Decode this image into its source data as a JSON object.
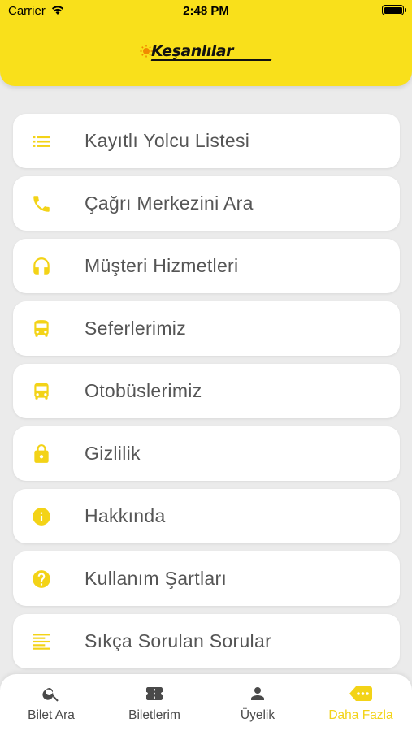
{
  "status_bar": {
    "carrier": "Carrier",
    "time": "2:48 PM"
  },
  "header": {
    "brand": "Keşanlılar"
  },
  "menu": {
    "items": [
      {
        "label": "Kayıtlı Yolcu Listesi",
        "icon": "list-icon"
      },
      {
        "label": "Çağrı Merkezini Ara",
        "icon": "phone-icon"
      },
      {
        "label": "Müşteri Hizmetleri",
        "icon": "headset-icon"
      },
      {
        "label": "Seferlerimiz",
        "icon": "bus-icon"
      },
      {
        "label": "Otobüslerimiz",
        "icon": "bus-icon"
      },
      {
        "label": "Gizlilik",
        "icon": "lock-icon"
      },
      {
        "label": "Hakkında",
        "icon": "info-icon"
      },
      {
        "label": "Kullanım Şartları",
        "icon": "help-icon"
      },
      {
        "label": "Sıkça Sorulan Sorular",
        "icon": "text-lines-icon"
      }
    ]
  },
  "tabbar": {
    "tabs": [
      {
        "label": "Bilet Ara",
        "icon": "search-icon"
      },
      {
        "label": "Biletlerim",
        "icon": "ticket-icon"
      },
      {
        "label": "Üyelik",
        "icon": "person-icon"
      },
      {
        "label": "Daha Fazla",
        "icon": "more-icon",
        "active": true
      }
    ]
  },
  "colors": {
    "accent": "#f9e01b",
    "icon_yellow": "#f3d317",
    "background": "#ebebeb",
    "text": "#555555"
  }
}
